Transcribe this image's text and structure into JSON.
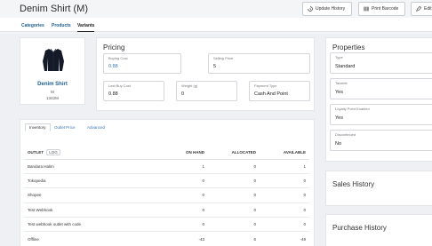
{
  "header": {
    "title": "Denim Shirt (M)",
    "update_history": "Update History",
    "print_barcode": "Print Barcode",
    "edit": "Edit"
  },
  "tabs": [
    "Categories",
    "Products",
    "Variants"
  ],
  "product": {
    "name": "Denim Shirt",
    "size": "M",
    "code": "1342M"
  },
  "pricing": {
    "title": "Pricing",
    "buying_cost_label": "Buying Cost",
    "buying_cost": "0.88",
    "selling_price_label": "Selling Price",
    "selling_price": "5",
    "last_buy_cost_label": "Last Buy Cost",
    "last_buy_cost": "0.88",
    "weight_label": "Weight (g)",
    "weight": "0",
    "payment_type_label": "Payment Type",
    "payment_type": "Cash And Point"
  },
  "properties": {
    "title": "Properties",
    "type_label": "Type",
    "type": "Standard",
    "taxable_label": "Taxable",
    "taxable": "Yes",
    "loyalty_label": "Loyalty Point Enabled",
    "loyalty": "Yes",
    "discontinued_label": "Discontinued",
    "discontinued": "No"
  },
  "inventory_tabs": [
    "Inventory",
    "Outlet Price",
    "Advanced"
  ],
  "inventory": {
    "headers": [
      "OUTLET",
      "ON HAND",
      "ALLOCATED",
      "AVAILABLE"
    ],
    "badge": "LOG",
    "rows": [
      [
        "Bandara Halim",
        "1",
        "0",
        "1"
      ],
      [
        "Tokopedia",
        "0",
        "0",
        "0"
      ],
      [
        "Shopee",
        "0",
        "0",
        "0"
      ],
      [
        "Test Webhook",
        "0",
        "0",
        "0"
      ],
      [
        "Test webhook outlet with code",
        "0",
        "0",
        "0"
      ],
      [
        "Offline",
        "-43",
        "6",
        "-49"
      ]
    ]
  },
  "sales_history": {
    "title": "Sales History"
  },
  "purchase_history": {
    "title": "Purchase History"
  }
}
